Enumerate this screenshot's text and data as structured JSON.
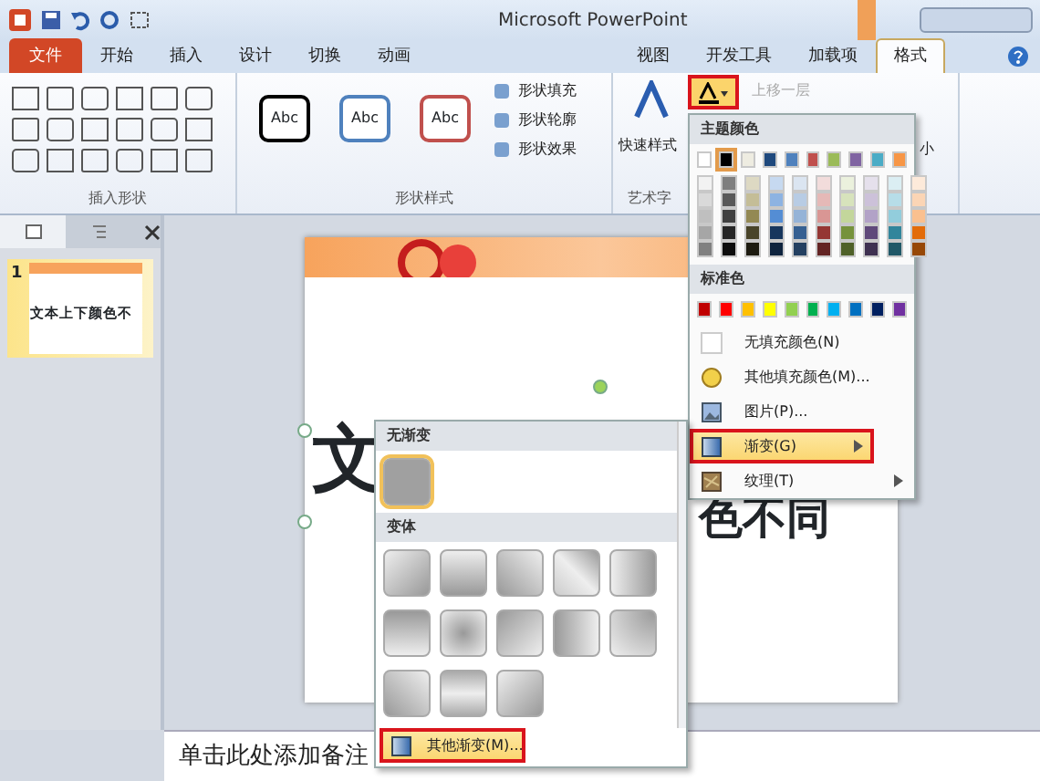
{
  "window": {
    "title": "Microsoft PowerPoint"
  },
  "ribbon_tabs": [
    {
      "label": "文件",
      "kind": "file",
      "selected": false
    },
    {
      "label": "开始",
      "kind": "tab",
      "selected": false
    },
    {
      "label": "插入",
      "kind": "tab",
      "selected": false
    },
    {
      "label": "设计",
      "kind": "tab",
      "selected": false
    },
    {
      "label": "切换",
      "kind": "tab",
      "selected": false
    },
    {
      "label": "动画",
      "kind": "tab",
      "selected": false
    },
    {
      "label": "视图",
      "kind": "tab",
      "selected": false
    },
    {
      "label": "开发工具",
      "kind": "tab",
      "selected": false
    },
    {
      "label": "加载项",
      "kind": "tab",
      "selected": false
    },
    {
      "label": "格式",
      "kind": "tab",
      "selected": true
    }
  ],
  "ribbon": {
    "groups": [
      "插入形状",
      "形状样式",
      "艺术字"
    ],
    "shape_styles": [
      {
        "label": "Abc",
        "color": "#000000"
      },
      {
        "label": "Abc",
        "color": "#4f81bd"
      },
      {
        "label": "Abc",
        "color": "#c0504d"
      }
    ],
    "shape_commands": [
      "形状填充",
      "形状轮廓",
      "形状效果"
    ],
    "quick_styles": "快速样式",
    "text_fill_highlighted": true,
    "bring_forward": {
      "label": "上移一层",
      "disabled": true
    },
    "size": "小"
  },
  "slides_pane": {
    "thumbnails": [
      {
        "number": "1",
        "title": "文本上下颜色不",
        "selected": true
      }
    ]
  },
  "slide": {
    "title_left": "文",
    "title_right": "色不同"
  },
  "notes": {
    "placeholder": "单击此处添加备注"
  },
  "color_menu": {
    "theme_header": "主题颜色",
    "theme_colors": [
      {
        "color": "#ffffff",
        "selected": false,
        "shades": [
          {
            "color": "#f2f2f2"
          },
          {
            "color": "#d9d9d9"
          },
          {
            "color": "#bfbfbf"
          },
          {
            "color": "#a6a6a6"
          },
          {
            "color": "#808080"
          }
        ]
      },
      {
        "color": "#000000",
        "selected": true,
        "shades": [
          {
            "color": "#7f7f7f"
          },
          {
            "color": "#595959"
          },
          {
            "color": "#404040"
          },
          {
            "color": "#262626"
          },
          {
            "color": "#0d0d0d"
          }
        ]
      },
      {
        "color": "#eeece1",
        "selected": false,
        "shades": [
          {
            "color": "#ddd9c3"
          },
          {
            "color": "#c4bd97"
          },
          {
            "color": "#938953"
          },
          {
            "color": "#494429"
          },
          {
            "color": "#1d1b10"
          }
        ]
      },
      {
        "color": "#1f497d",
        "selected": false,
        "shades": [
          {
            "color": "#c6d9f0"
          },
          {
            "color": "#8db3e2"
          },
          {
            "color": "#548dd4"
          },
          {
            "color": "#17365d"
          },
          {
            "color": "#0f243e"
          }
        ]
      },
      {
        "color": "#4f81bd",
        "selected": false,
        "shades": [
          {
            "color": "#dbe5f1"
          },
          {
            "color": "#b8cce4"
          },
          {
            "color": "#95b3d7"
          },
          {
            "color": "#366092"
          },
          {
            "color": "#244061"
          }
        ]
      },
      {
        "color": "#c0504d",
        "selected": false,
        "shades": [
          {
            "color": "#f2dcdb"
          },
          {
            "color": "#e5b9b7"
          },
          {
            "color": "#d99694"
          },
          {
            "color": "#953734"
          },
          {
            "color": "#632423"
          }
        ]
      },
      {
        "color": "#9bbb59",
        "selected": false,
        "shades": [
          {
            "color": "#ebf1dd"
          },
          {
            "color": "#d7e3bc"
          },
          {
            "color": "#c3d69b"
          },
          {
            "color": "#76923c"
          },
          {
            "color": "#4f6128"
          }
        ]
      },
      {
        "color": "#8064a2",
        "selected": false,
        "shades": [
          {
            "color": "#e5e0ec"
          },
          {
            "color": "#ccc1d9"
          },
          {
            "color": "#b2a2c7"
          },
          {
            "color": "#5f497a"
          },
          {
            "color": "#3f3151"
          }
        ]
      },
      {
        "color": "#4bacc6",
        "selected": false,
        "shades": [
          {
            "color": "#dbeef3"
          },
          {
            "color": "#b7dde8"
          },
          {
            "color": "#92cddc"
          },
          {
            "color": "#31859b"
          },
          {
            "color": "#205867"
          }
        ]
      },
      {
        "color": "#f79646",
        "selected": false,
        "shades": [
          {
            "color": "#fdeada"
          },
          {
            "color": "#fbd5b5"
          },
          {
            "color": "#fac08f"
          },
          {
            "color": "#e36c09"
          },
          {
            "color": "#974806"
          }
        ]
      }
    ],
    "standard_header": "标准色",
    "standard_colors": [
      {
        "color": "#c00000"
      },
      {
        "color": "#ff0000"
      },
      {
        "color": "#ffc000"
      },
      {
        "color": "#ffff00"
      },
      {
        "color": "#92d050"
      },
      {
        "color": "#00b050"
      },
      {
        "color": "#00b0f0"
      },
      {
        "color": "#0070c0"
      },
      {
        "color": "#002060"
      },
      {
        "color": "#7030a0"
      }
    ],
    "items": [
      {
        "label": "无填充颜色(N)",
        "kind": "none",
        "submenu": false,
        "selected": false,
        "highlight_box": false
      },
      {
        "label": "其他填充颜色(M)...",
        "kind": "palette",
        "submenu": false,
        "selected": false,
        "highlight_box": false
      },
      {
        "label": "图片(P)...",
        "kind": "picture",
        "submenu": false,
        "selected": false,
        "highlight_box": false
      },
      {
        "label": "渐变(G)",
        "kind": "gradient",
        "submenu": true,
        "selected": true,
        "highlight_box": true
      },
      {
        "label": "纹理(T)",
        "kind": "texture",
        "submenu": true,
        "selected": false,
        "highlight_box": false
      }
    ]
  },
  "gradient_menu": {
    "none_header": "无渐变",
    "none_swatches": [
      {
        "selected": true
      }
    ],
    "variants_header": "变体",
    "variants": [
      {
        "selected": false
      },
      {
        "selected": false
      },
      {
        "selected": false
      },
      {
        "selected": false
      },
      {
        "selected": false
      },
      {
        "selected": false
      },
      {
        "selected": false
      },
      {
        "selected": false
      },
      {
        "selected": false
      },
      {
        "selected": false
      },
      {
        "selected": false
      },
      {
        "selected": false
      },
      {
        "selected": false
      }
    ],
    "more": {
      "label": "其他渐变(M)...",
      "selected": true,
      "highlight_box": true
    }
  }
}
